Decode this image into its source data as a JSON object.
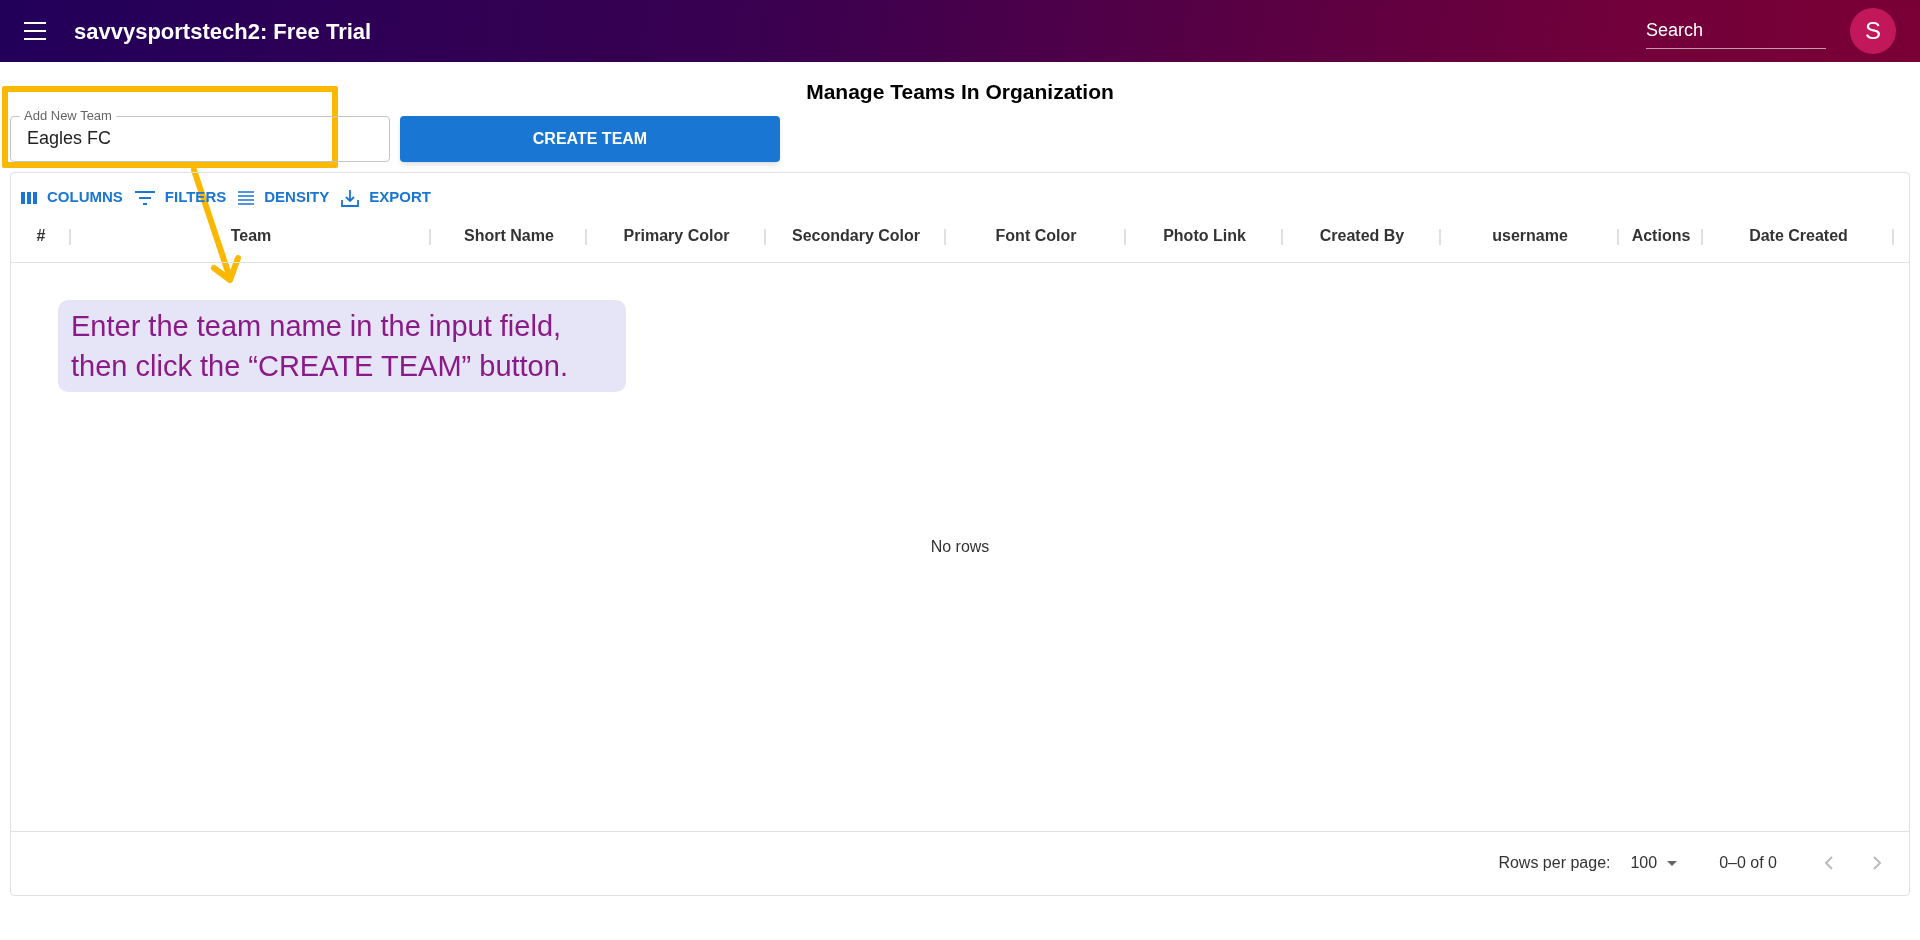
{
  "app_bar": {
    "title": "savvysportstech2: Free Trial",
    "search": {
      "placeholder": "Search"
    },
    "avatar": "S"
  },
  "page_title": "Manage Teams In Organization",
  "add_team": {
    "label": "Add New Team",
    "value": "Eagles FC"
  },
  "create_button": "CREATE TEAM",
  "toolbar": [
    {
      "kind": "columns",
      "label": "COLUMNS"
    },
    {
      "kind": "filters",
      "label": "FILTERS"
    },
    {
      "kind": "density",
      "label": "DENSITY"
    },
    {
      "kind": "export",
      "label": "EXPORT"
    }
  ],
  "table": {
    "columns": [
      "#",
      "Team",
      "Short Name",
      "Primary Color",
      "Secondary Color",
      "Font Color",
      "Photo Link",
      "Created By",
      "username",
      "Actions",
      "Date Created"
    ],
    "empty_message": "No rows"
  },
  "footer": {
    "rows_per_page_label": "Rows per page:",
    "rows_per_page": "100",
    "range": "0–0 of 0"
  },
  "annotation": {
    "text": "Enter the team name in the input field, then click the “CREATE TEAM” button."
  }
}
